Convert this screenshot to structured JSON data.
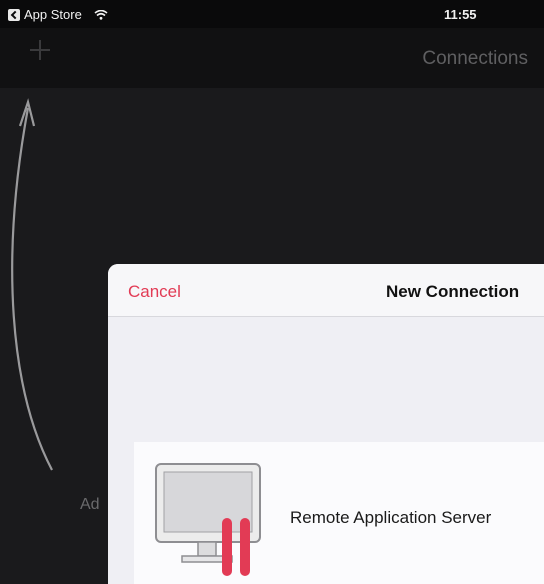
{
  "status_bar": {
    "back_app": "App Store",
    "time": "11:55"
  },
  "nav": {
    "title": "Connections"
  },
  "hint": {
    "text": "Ad"
  },
  "sheet": {
    "cancel": "Cancel",
    "title": "New Connection",
    "options": [
      {
        "label": "Remote Application Server",
        "icon": "monitor-icon"
      }
    ]
  },
  "colors": {
    "accent": "#e23b55",
    "background": "#111112",
    "sheet": "#efeff4"
  }
}
